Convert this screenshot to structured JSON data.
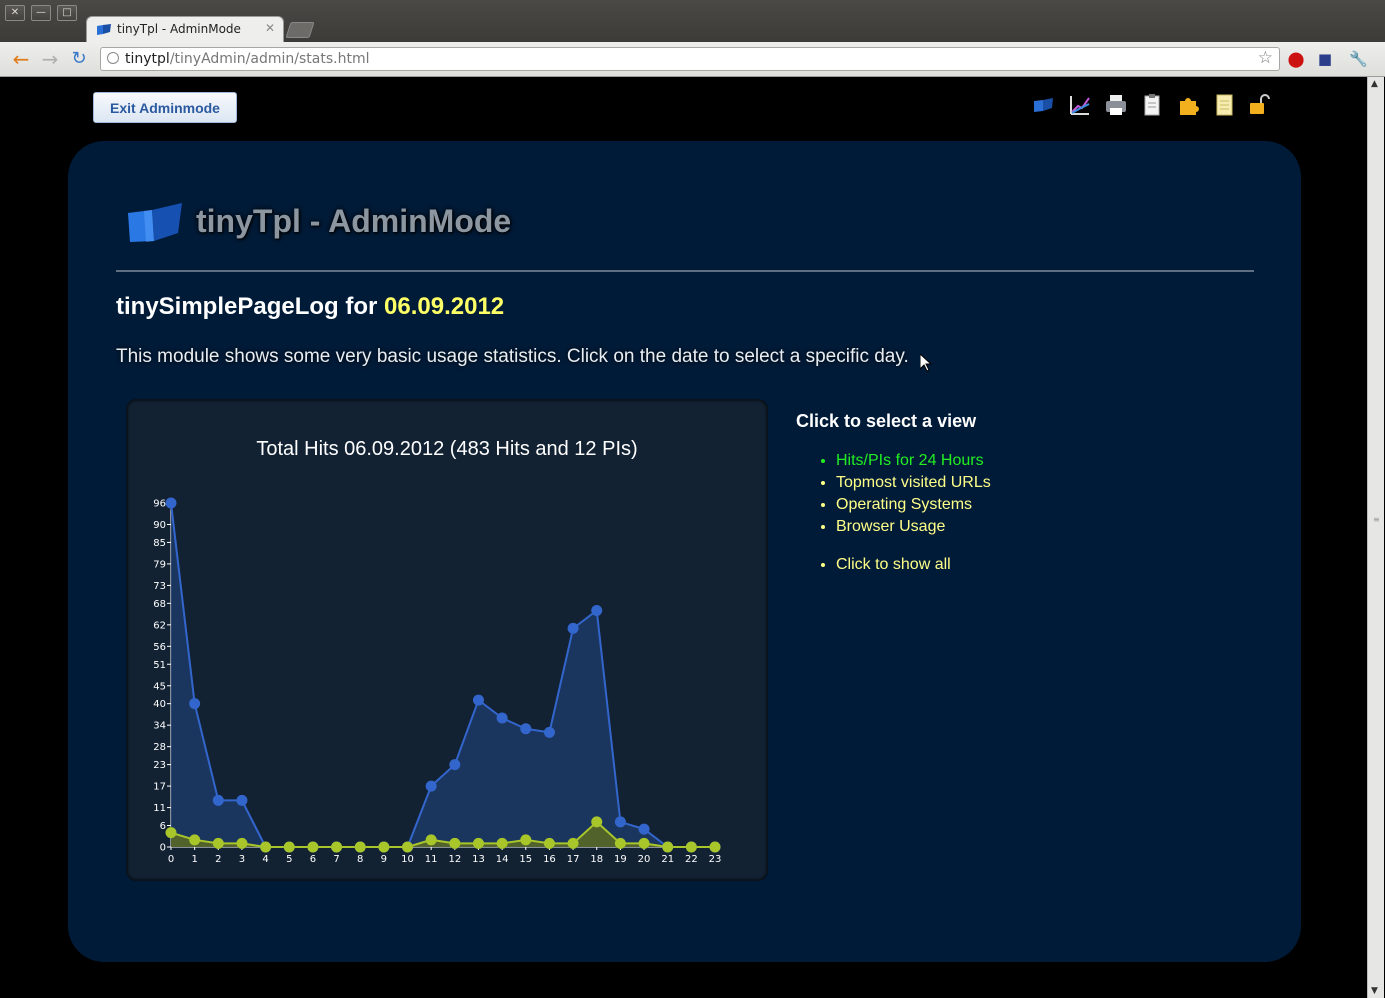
{
  "browser": {
    "tab_title": "tinyTpl - AdminMode",
    "url_host": "tinytpl",
    "url_path": "/tinyAdmin/admin/stats.html"
  },
  "page": {
    "exit_button": "Exit Adminmode",
    "admin_icons": [
      "tinytpl-logo-icon",
      "stats-chart-icon",
      "printer-icon",
      "clipboard-icon",
      "puzzle-icon",
      "document-icon",
      "unlock-icon"
    ],
    "app_title": "tinyTpl - AdminMode",
    "heading_prefix": "tinySimplePageLog for ",
    "heading_date": "06.09.2012",
    "description": "This module shows some very basic usage statistics. Click on the date to select a specific day.",
    "views": {
      "title": "Click to select a view",
      "items": [
        {
          "label": "Hits/PIs for 24 Hours",
          "active": true
        },
        {
          "label": "Topmost visited URLs",
          "active": false
        },
        {
          "label": "Operating Systems",
          "active": false
        },
        {
          "label": "Browser Usage",
          "active": false
        }
      ],
      "show_all": "Click to show all"
    },
    "colors": {
      "panel": "#001b38",
      "hits_series": "#3366cc",
      "pis_series": "#a8c62a",
      "date_highlight": "#ffff66",
      "active_view": "#22ee22"
    }
  },
  "chart_data": {
    "type": "area",
    "title": "Total Hits 06.09.2012 (483 Hits and 12 PIs)",
    "x": [
      0,
      1,
      2,
      3,
      4,
      5,
      6,
      7,
      8,
      9,
      10,
      11,
      12,
      13,
      14,
      15,
      16,
      17,
      18,
      19,
      20,
      21,
      22,
      23
    ],
    "y_ticks": [
      0,
      6,
      11,
      17,
      23,
      28,
      34,
      40,
      45,
      51,
      56,
      62,
      68,
      73,
      79,
      85,
      90,
      96
    ],
    "ylim": [
      0,
      96
    ],
    "series": [
      {
        "values": [
          96,
          40,
          13,
          13,
          0,
          0,
          0,
          0,
          0,
          0,
          0,
          17,
          23,
          41,
          36,
          33,
          32,
          61,
          66,
          7,
          5,
          0,
          0,
          0
        ]
      },
      {
        "values": [
          4,
          2,
          1,
          1,
          0,
          0,
          0,
          0,
          0,
          0,
          0,
          2,
          1,
          1,
          1,
          2,
          1,
          1,
          7,
          1,
          1,
          0,
          0,
          0
        ]
      }
    ]
  }
}
